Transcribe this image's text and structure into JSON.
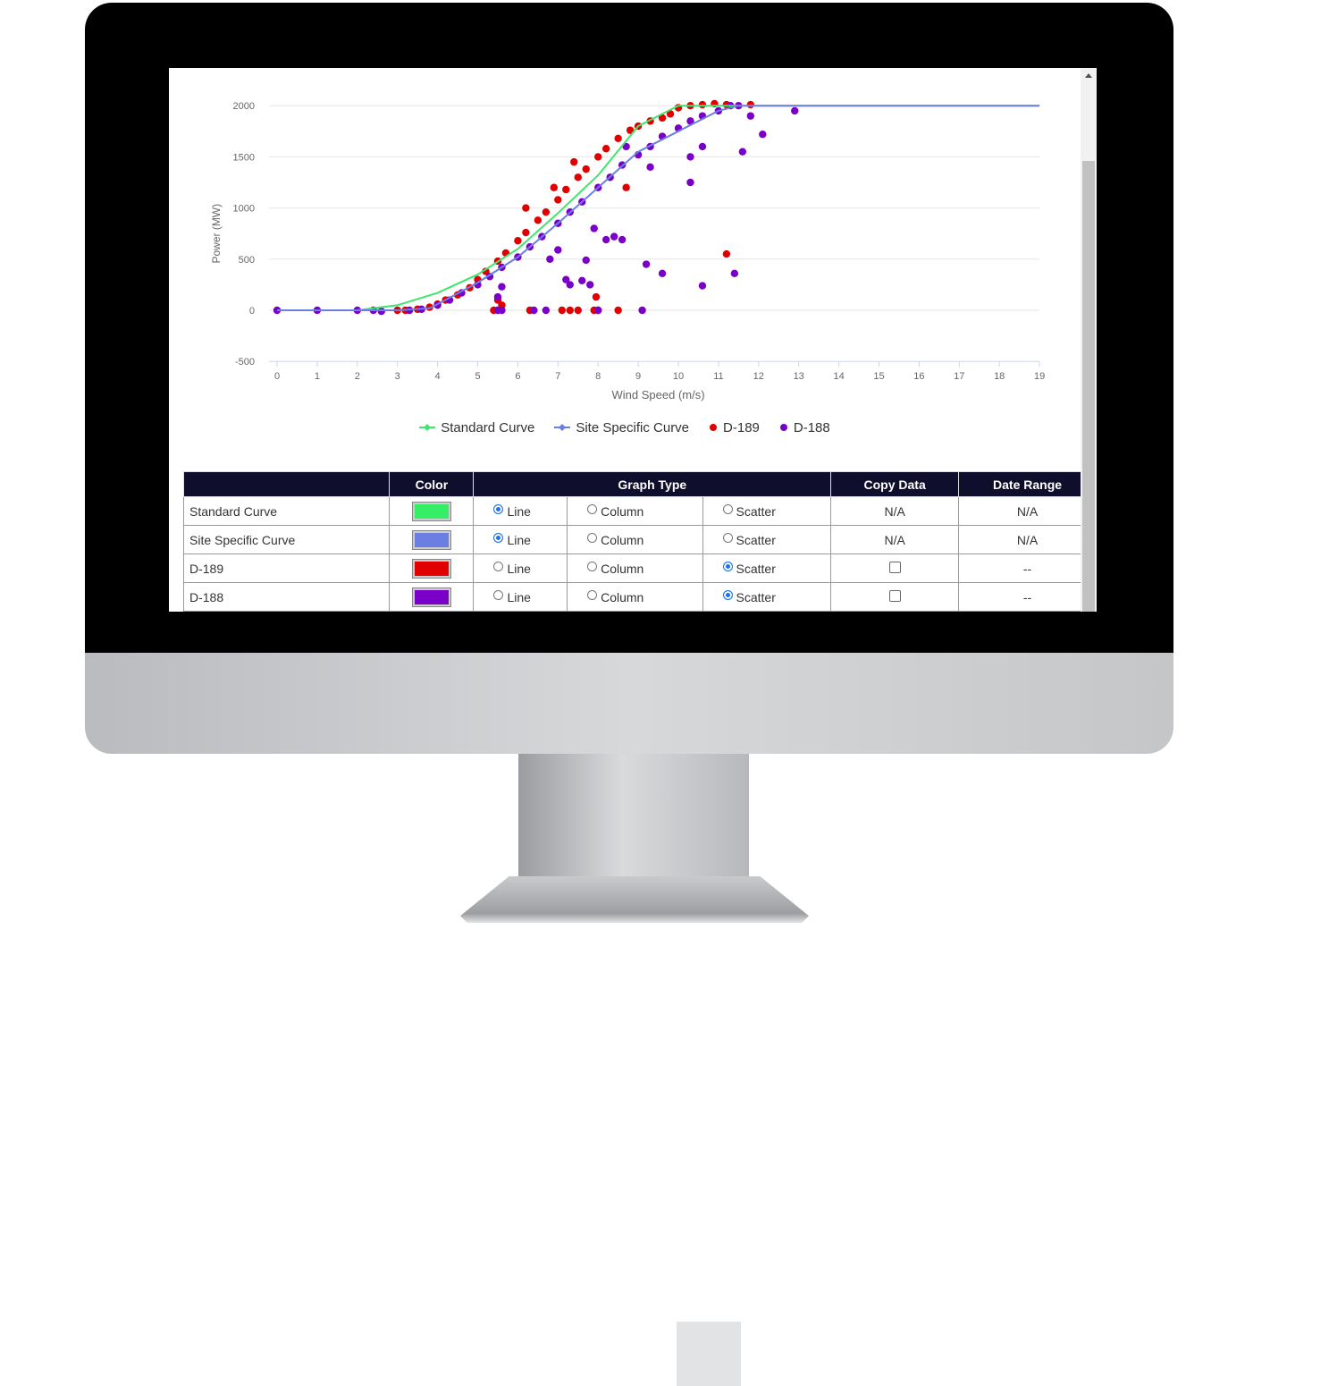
{
  "chart_data": {
    "type": "scatter",
    "xlabel": "Wind Speed (m/s)",
    "ylabel": "Power (MW)",
    "xlim": [
      0,
      19
    ],
    "ylim": [
      -500,
      2000
    ],
    "xticks": [
      "0",
      "1",
      "2",
      "3",
      "4",
      "5",
      "6",
      "7",
      "8",
      "9",
      "10",
      "11",
      "12",
      "13",
      "14",
      "15",
      "16",
      "17",
      "18",
      "19"
    ],
    "yticks": [
      "2000",
      "1500",
      "1000",
      "500",
      "0",
      "-500"
    ],
    "grid": true,
    "legend_placement": "bottom",
    "series": [
      {
        "name": "Standard Curve",
        "type": "line",
        "color": "#3ee66b",
        "points": [
          [
            0,
            0
          ],
          [
            1,
            0
          ],
          [
            2,
            0
          ],
          [
            3,
            50
          ],
          [
            4,
            170
          ],
          [
            5,
            350
          ],
          [
            6,
            600
          ],
          [
            7,
            950
          ],
          [
            8,
            1320
          ],
          [
            9,
            1800
          ],
          [
            10,
            2000
          ],
          [
            19,
            2000
          ]
        ]
      },
      {
        "name": "Site Specific Curve",
        "type": "line",
        "color": "#6b7fe3",
        "points": [
          [
            0,
            0
          ],
          [
            1,
            0
          ],
          [
            2,
            0
          ],
          [
            3,
            0
          ],
          [
            3.8,
            20
          ],
          [
            4,
            60
          ],
          [
            5,
            270
          ],
          [
            6,
            520
          ],
          [
            7,
            850
          ],
          [
            8,
            1200
          ],
          [
            9,
            1550
          ],
          [
            10,
            1750
          ],
          [
            11,
            1950
          ],
          [
            11.5,
            2000
          ],
          [
            19,
            2000
          ]
        ]
      },
      {
        "name": "D-189",
        "type": "scatter",
        "color": "#e00000",
        "points": [
          [
            3,
            0
          ],
          [
            3.2,
            0
          ],
          [
            3.5,
            10
          ],
          [
            3.8,
            30
          ],
          [
            4,
            60
          ],
          [
            4.2,
            100
          ],
          [
            4.5,
            150
          ],
          [
            4.8,
            220
          ],
          [
            5,
            300
          ],
          [
            5.2,
            380
          ],
          [
            5.5,
            480
          ],
          [
            5.7,
            560
          ],
          [
            6,
            680
          ],
          [
            6.2,
            760
          ],
          [
            6.5,
            880
          ],
          [
            6.7,
            960
          ],
          [
            7,
            1080
          ],
          [
            7.2,
            1180
          ],
          [
            7.5,
            1300
          ],
          [
            7.7,
            1380
          ],
          [
            8,
            1500
          ],
          [
            8.2,
            1580
          ],
          [
            8.5,
            1680
          ],
          [
            8.8,
            1760
          ],
          [
            9,
            1800
          ],
          [
            9.3,
            1850
          ],
          [
            9.6,
            1880
          ],
          [
            9.8,
            1920
          ],
          [
            10,
            1980
          ],
          [
            10.3,
            2000
          ],
          [
            10.6,
            2010
          ],
          [
            10.9,
            2020
          ],
          [
            11.2,
            2010
          ],
          [
            11.8,
            2010
          ],
          [
            5.5,
            100
          ],
          [
            5.6,
            50
          ],
          [
            5.4,
            0
          ],
          [
            6.3,
            0
          ],
          [
            7.1,
            0
          ],
          [
            7.3,
            0
          ],
          [
            7.5,
            0
          ],
          [
            7.9,
            0
          ],
          [
            7.95,
            130
          ],
          [
            8,
            0
          ],
          [
            8.5,
            0
          ],
          [
            8.7,
            1200
          ],
          [
            11.2,
            550
          ],
          [
            6.2,
            1000
          ],
          [
            7.4,
            1450
          ],
          [
            6.9,
            1200
          ]
        ]
      },
      {
        "name": "D-188",
        "type": "scatter",
        "color": "#7a00c8",
        "points": [
          [
            0,
            0
          ],
          [
            1,
            0
          ],
          [
            2,
            0
          ],
          [
            2.4,
            0
          ],
          [
            2.6,
            -10
          ],
          [
            3.3,
            0
          ],
          [
            3.6,
            10
          ],
          [
            4,
            50
          ],
          [
            4.3,
            100
          ],
          [
            4.6,
            170
          ],
          [
            5,
            250
          ],
          [
            5.3,
            330
          ],
          [
            5.6,
            420
          ],
          [
            6,
            520
          ],
          [
            6.3,
            620
          ],
          [
            6.6,
            720
          ],
          [
            7,
            850
          ],
          [
            7.3,
            960
          ],
          [
            7.6,
            1060
          ],
          [
            8,
            1200
          ],
          [
            8.3,
            1300
          ],
          [
            8.6,
            1420
          ],
          [
            9,
            1520
          ],
          [
            9.3,
            1600
          ],
          [
            9.6,
            1700
          ],
          [
            10,
            1780
          ],
          [
            10.3,
            1850
          ],
          [
            10.6,
            1900
          ],
          [
            11,
            1950
          ],
          [
            11.3,
            2000
          ],
          [
            11.5,
            2000
          ],
          [
            12.9,
            1950
          ],
          [
            11.8,
            1900
          ],
          [
            12.1,
            1720
          ],
          [
            11.6,
            1550
          ],
          [
            10.3,
            1500
          ],
          [
            10.3,
            1250
          ],
          [
            9.3,
            1400
          ],
          [
            8.7,
            1600
          ],
          [
            10.6,
            1600
          ],
          [
            7.7,
            490
          ],
          [
            8.2,
            690
          ],
          [
            8.4,
            720
          ],
          [
            8.6,
            690
          ],
          [
            7.9,
            800
          ],
          [
            7.0,
            590
          ],
          [
            6.8,
            500
          ],
          [
            7.2,
            300
          ],
          [
            7.3,
            250
          ],
          [
            7.6,
            290
          ],
          [
            7.8,
            250
          ],
          [
            9.2,
            450
          ],
          [
            9.6,
            360
          ],
          [
            10.6,
            240
          ],
          [
            11.4,
            360
          ],
          [
            5.6,
            230
          ],
          [
            5.5,
            130
          ],
          [
            5.5,
            0
          ],
          [
            5.6,
            0
          ],
          [
            6.7,
            0
          ],
          [
            8.0,
            0
          ],
          [
            9.1,
            0
          ],
          [
            6.4,
            0
          ]
        ]
      }
    ]
  },
  "legend": [
    {
      "label": "Standard Curve",
      "color": "#3ee66b",
      "marker": "line-diamond"
    },
    {
      "label": "Site Specific Curve",
      "color": "#6b7fe3",
      "marker": "line-diamond"
    },
    {
      "label": "D-189",
      "color": "#e00000",
      "marker": "dot"
    },
    {
      "label": "D-188",
      "color": "#7a00c8",
      "marker": "dot"
    }
  ],
  "table": {
    "headers": [
      "",
      "Color",
      "Graph Type",
      "Copy Data",
      "Date Range"
    ],
    "graph_type_options": [
      "Line",
      "Column",
      "Scatter"
    ],
    "rows": [
      {
        "name": "Standard Curve",
        "color": "#33ee66",
        "graph_type": "Line",
        "copy_data": "N/A",
        "date_range": "N/A"
      },
      {
        "name": "Site Specific Curve",
        "color": "#6b7fe3",
        "graph_type": "Line",
        "copy_data": "N/A",
        "date_range": "N/A"
      },
      {
        "name": "D-189",
        "color": "#e00000",
        "graph_type": "Scatter",
        "copy_data": "",
        "date_range": "--"
      },
      {
        "name": "D-188",
        "color": "#7a00c8",
        "graph_type": "Scatter",
        "copy_data": "",
        "date_range": "--"
      }
    ]
  }
}
